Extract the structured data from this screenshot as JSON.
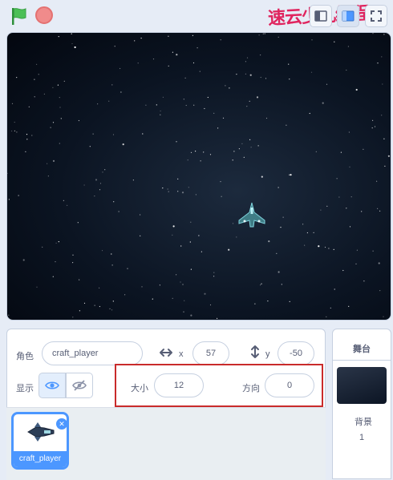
{
  "watermark": "速云少儿编程",
  "icons": {
    "green_flag": "green-flag-icon",
    "stop": "stop-icon",
    "small_stage": "small-stage-icon",
    "normal_stage": "normal-stage-icon",
    "fullscreen": "fullscreen-icon",
    "x_arrows": "horizontal-arrows-icon",
    "y_arrows": "vertical-arrows-icon",
    "show": "eye-icon",
    "hide": "eye-slash-icon",
    "delete": "close-icon"
  },
  "colors": {
    "accent": "#4c97ff",
    "highlight": "#c92b2b",
    "flag": "#4cbf56"
  },
  "sprite_info": {
    "sprite_label": "角色",
    "sprite_name": "craft_player",
    "x_label": "x",
    "x_value": "57",
    "y_label": "y",
    "y_value": "-50",
    "show_label": "显示",
    "size_label": "大小",
    "size_value": "12",
    "direction_label": "方向",
    "direction_value": "0"
  },
  "sprites": [
    {
      "name": "craft_player",
      "selected": true
    }
  ],
  "stage_panel": {
    "title": "舞台",
    "backdrop_label": "背景",
    "backdrop_count": "1"
  }
}
